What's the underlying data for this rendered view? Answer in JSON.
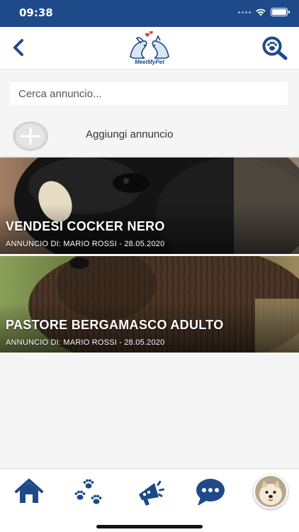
{
  "status_bar": {
    "time": "09:38"
  },
  "header": {
    "logo_text": "MeetMyPet"
  },
  "search": {
    "placeholder": "Cerca annuncio..."
  },
  "add_announcement": {
    "label": "Aggiungi annuncio"
  },
  "listings": [
    {
      "title": "VENDESI COCKER NERO",
      "meta": "ANNUNCIO DI: MARIO ROSSI - 28.05.2020"
    },
    {
      "title": "PASTORE BERGAMASCO ADULTO",
      "meta": "ANNUNCIO DI: MARIO ROSSI - 28.05.2020"
    }
  ],
  "tabbar": {
    "items": [
      {
        "icon": "home-icon"
      },
      {
        "icon": "paw-prints-icon"
      },
      {
        "icon": "megaphone-icon"
      },
      {
        "icon": "chat-bubble-icon"
      },
      {
        "icon": "profile-avatar"
      }
    ]
  },
  "colors": {
    "brand": "#1e4a8a",
    "background": "#f5f5f5"
  }
}
